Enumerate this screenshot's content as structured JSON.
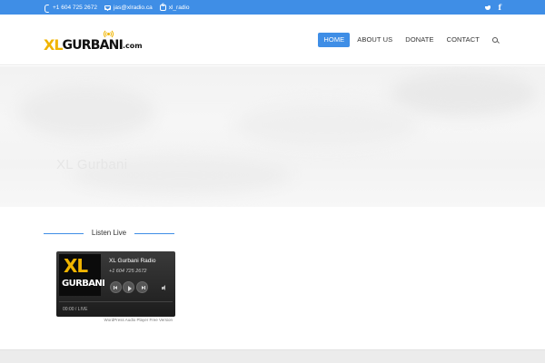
{
  "topbar": {
    "phone": "+1 604 725 2672",
    "email": "jas@xlradio.ca",
    "skype": "xl_radio",
    "social": [
      "twitter-icon",
      "facebook-icon"
    ]
  },
  "header": {
    "logo": {
      "xl": "XL",
      "gurbani": "GURBANI",
      "tld": ".com"
    },
    "nav": [
      {
        "label": "HOME",
        "active": true
      },
      {
        "label": "ABOUT US",
        "active": false
      },
      {
        "label": "DONATE",
        "active": false
      },
      {
        "label": "CONTACT",
        "active": false
      }
    ]
  },
  "hero": {
    "title": "XL Gurbani"
  },
  "listen_live": {
    "heading": "Listen Live"
  },
  "player": {
    "art_xl": "XL",
    "art_gurbani": "GURBANI",
    "station": "XL Gurbani Radio",
    "phone": "+1 604 725 2672",
    "time": "00:00 / LIVE",
    "credit": "WordPress Audio Player Free Version"
  },
  "colors": {
    "accent": "#3f8ee6",
    "brand_yellow": "#f0b400"
  }
}
